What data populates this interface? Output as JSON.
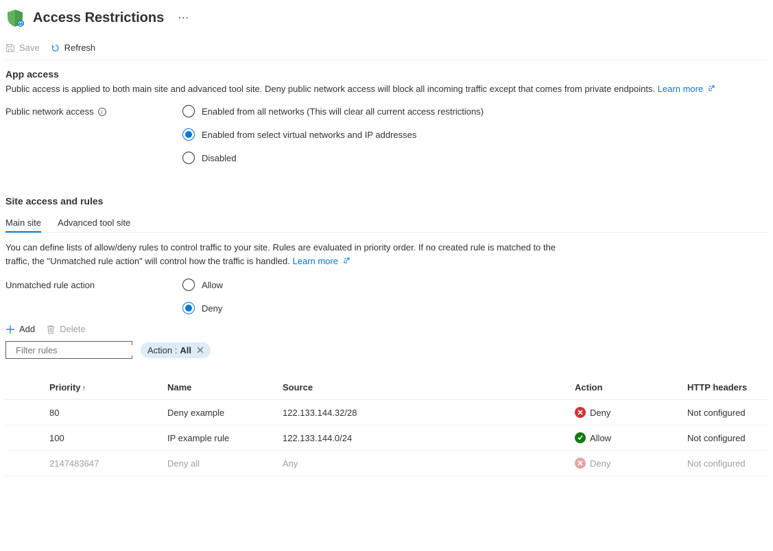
{
  "header": {
    "title": "Access Restrictions"
  },
  "toolbar": {
    "save": "Save",
    "refresh": "Refresh"
  },
  "app_access": {
    "title": "App access",
    "desc": "Public access is applied to both main site and advanced tool site. Deny public network access will block all incoming traffic except that comes from private endpoints.",
    "learn_more": "Learn more",
    "label": "Public network access",
    "options": {
      "enabled_all": "Enabled from all networks (This will clear all current access restrictions)",
      "enabled_select": "Enabled from select virtual networks and IP addresses",
      "disabled": "Disabled"
    },
    "selected": "enabled_select"
  },
  "site_access": {
    "title": "Site access and rules",
    "tabs": {
      "main": "Main site",
      "advanced": "Advanced tool site"
    },
    "active_tab": "main",
    "desc": "You can define lists of allow/deny rules to control traffic to your site. Rules are evaluated in priority order. If no created rule is matched to the traffic, the \"Unmatched rule action\" will control how the traffic is handled.",
    "learn_more": "Learn more",
    "unmatched_label": "Unmatched rule action",
    "unmatched_options": {
      "allow": "Allow",
      "deny": "Deny"
    },
    "unmatched_selected": "deny"
  },
  "rules_actions": {
    "add": "Add",
    "delete": "Delete"
  },
  "filter": {
    "placeholder": "Filter rules",
    "pill_label": "Action :",
    "pill_value": "All"
  },
  "table": {
    "headers": {
      "priority": "Priority",
      "name": "Name",
      "source": "Source",
      "action": "Action",
      "http_headers": "HTTP headers"
    },
    "rows": [
      {
        "priority": "80",
        "name": "Deny example",
        "source": "122.133.144.32/28",
        "action": "Deny",
        "action_type": "deny",
        "http_headers": "Not configured",
        "faded": false
      },
      {
        "priority": "100",
        "name": "IP example rule",
        "source": "122.133.144.0/24",
        "action": "Allow",
        "action_type": "allow",
        "http_headers": "Not configured",
        "faded": false
      },
      {
        "priority": "2147483647",
        "name": "Deny all",
        "source": "Any",
        "action": "Deny",
        "action_type": "deny",
        "http_headers": "Not configured",
        "faded": true
      }
    ]
  }
}
